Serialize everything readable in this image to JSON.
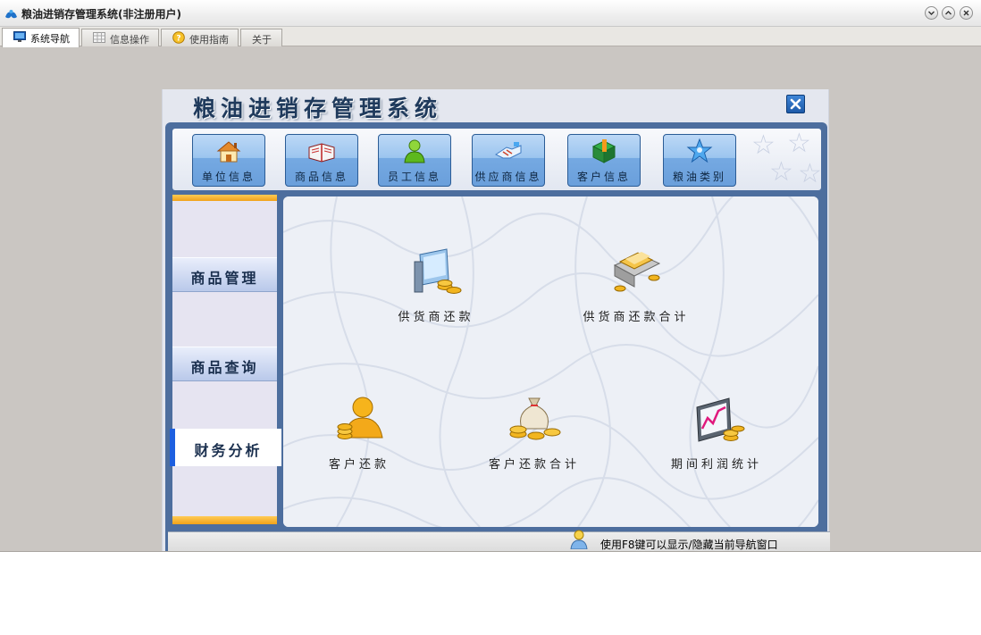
{
  "window": {
    "title": "粮油进销存管理系统(非注册用户)",
    "buttons": [
      "minimize",
      "maximize",
      "close"
    ]
  },
  "tabs": [
    {
      "label": "系统导航",
      "icon": "monitor-icon",
      "active": true
    },
    {
      "label": "信息操作",
      "icon": "grid-icon",
      "active": false
    },
    {
      "label": "使用指南",
      "icon": "help-icon",
      "active": false
    },
    {
      "label": "关于",
      "icon": "",
      "active": false
    }
  ],
  "panel": {
    "title": "粮油进销存管理系统",
    "close_icon": "close-icon"
  },
  "toolbar": {
    "buttons": [
      {
        "label": "单位信息",
        "icon": "house-icon"
      },
      {
        "label": "商品信息",
        "icon": "book-icon"
      },
      {
        "label": "员工信息",
        "icon": "person-icon"
      },
      {
        "label": "供应商信息",
        "icon": "handshake-icon"
      },
      {
        "label": "客户信息",
        "icon": "cube-icon"
      },
      {
        "label": "粮油类别",
        "icon": "star-person-icon"
      }
    ]
  },
  "sidebar": {
    "items": [
      {
        "label": "商品管理",
        "active": false
      },
      {
        "label": "商品查询",
        "active": false
      },
      {
        "label": "财务分析",
        "active": true
      }
    ]
  },
  "content": {
    "functions": [
      {
        "label": "供货商还款",
        "icon": "computer-coins-icon"
      },
      {
        "label": "供货商还款合计",
        "icon": "money-boxes-icon"
      },
      {
        "label": "客户还款",
        "icon": "person-coins-icon"
      },
      {
        "label": "客户还款合计",
        "icon": "moneybag-coins-icon"
      },
      {
        "label": "期间利润统计",
        "icon": "chart-coins-icon"
      }
    ]
  },
  "status": {
    "text": "使用F8键可以显示/隐藏当前导航窗口",
    "icon": "helper-person-icon"
  },
  "colors": {
    "accent": "#1d5fe0",
    "frame": "#4d6e9e",
    "button_blue": "#75a9e2",
    "band_orange": "#f0a21a"
  }
}
